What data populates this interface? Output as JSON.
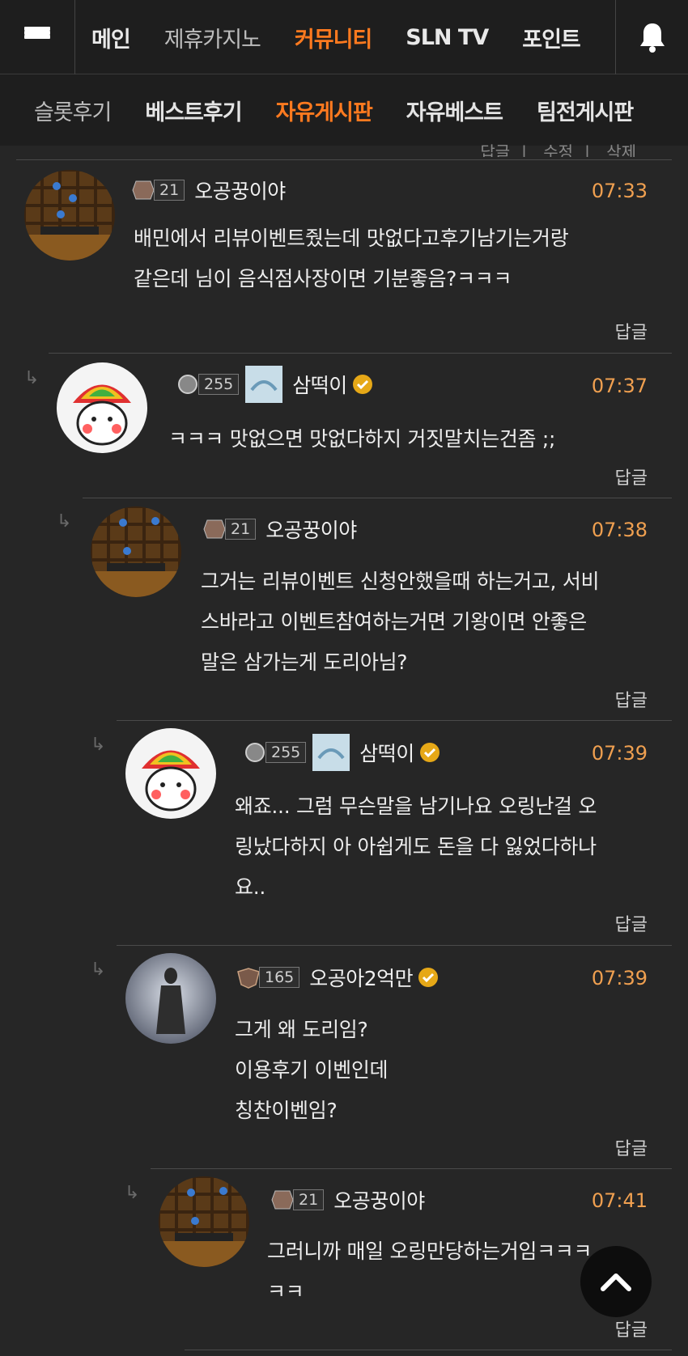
{
  "topnav": {
    "items": [
      {
        "label": "메인",
        "state": "normal"
      },
      {
        "label": "제휴카지노",
        "state": "dim"
      },
      {
        "label": "커뮤니티",
        "state": "active"
      },
      {
        "label": "SLN TV",
        "state": "normal"
      },
      {
        "label": "포인트",
        "state": "normal"
      }
    ]
  },
  "subnav": {
    "items": [
      {
        "label": "슬롯후기",
        "state": "dim"
      },
      {
        "label": "베스트후기",
        "state": "normal"
      },
      {
        "label": "자유게시판",
        "state": "active"
      },
      {
        "label": "자유베스트",
        "state": "normal"
      },
      {
        "label": "팀전게시판",
        "state": "normal"
      }
    ]
  },
  "peek": {
    "items": [
      "답글",
      "수정",
      "삭제"
    ]
  },
  "comments": [
    {
      "level": "21",
      "nick": "오공꿍이야",
      "verified": false,
      "time": "07:33",
      "lines": [
        "배민에서 리뷰이벤트줬는데 맛없다고후기남기는거랑",
        "같은데  님이 음식점사장이면 기분좋음?ㅋㅋㅋ"
      ],
      "reply": "답글"
    },
    {
      "level": "255",
      "nick": "삼떡이",
      "verified": true,
      "time": "07:37",
      "lines": [
        "ㅋㅋㅋ 맛없으면 맛없다하지 거짓말치는건좀 ;;"
      ],
      "reply": "답글"
    },
    {
      "level": "21",
      "nick": "오공꿍이야",
      "verified": false,
      "time": "07:38",
      "lines": [
        "그거는 리뷰이벤트 신청안했을때 하는거고, 서비",
        "스바라고 이벤트참여하는거면 기왕이면 안좋은",
        "말은 삼가는게 도리아님?"
      ],
      "reply": "답글"
    },
    {
      "level": "255",
      "nick": "삼떡이",
      "verified": true,
      "time": "07:39",
      "lines": [
        "왜죠... 그럼 무슨말을 남기나요 오링난걸 오",
        "링났다하지 아 아쉽게도 돈을 다 잃었다하나",
        "요.."
      ],
      "reply": "답글"
    },
    {
      "level": "165",
      "nick": "오공아2억만",
      "verified": true,
      "time": "07:39",
      "lines": [
        "그게 왜 도리임?",
        "이용후기 이벤인데",
        "칭찬이벤임?"
      ],
      "reply": "답글"
    },
    {
      "level": "21",
      "nick": "오공꿍이야",
      "verified": false,
      "time": "07:41",
      "lines": [
        "그러니까 매일 오링만당하는거임ㅋㅋㅋ",
        "ㅋㅋ"
      ],
      "reply": "답글"
    }
  ],
  "colors": {
    "accent": "#ff7a1f",
    "time": "#f0a050",
    "background": "#262626",
    "verified": "#e6a817"
  }
}
